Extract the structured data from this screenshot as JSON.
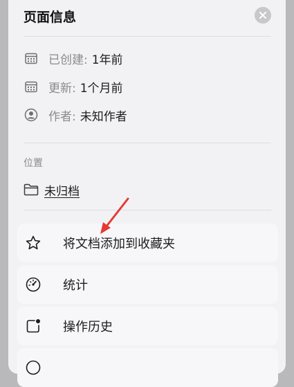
{
  "panel": {
    "title": "页面信息"
  },
  "meta": [
    {
      "key": "已创建:",
      "value": "1年前",
      "icon": "calendar-icon"
    },
    {
      "key": "更新:",
      "value": "1个月前",
      "icon": "calendar-icon"
    },
    {
      "key": "作者:",
      "value": "未知作者",
      "icon": "person-circle-icon"
    }
  ],
  "location": {
    "label": "位置",
    "value": "未归档",
    "icon": "folder-icon"
  },
  "actions": [
    {
      "label": "将文档添加到收藏夹",
      "icon": "star-icon"
    },
    {
      "label": "统计",
      "icon": "gauge-icon"
    },
    {
      "label": "操作历史",
      "icon": "history-square-icon"
    }
  ],
  "colors": {
    "annotation_arrow": "#e53935"
  }
}
